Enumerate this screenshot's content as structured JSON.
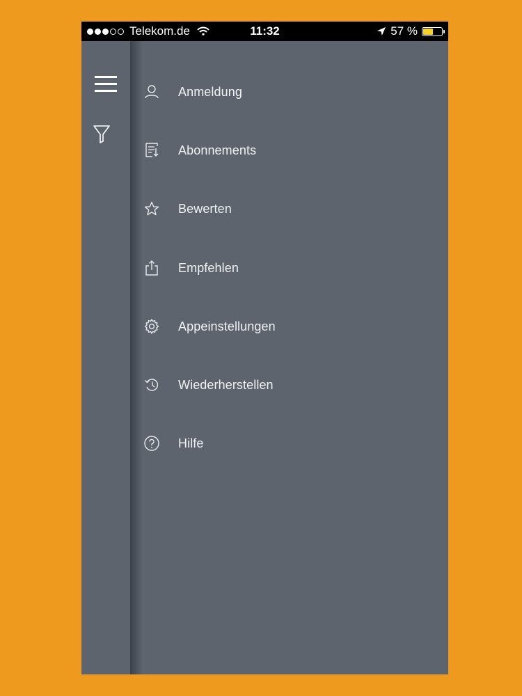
{
  "status_bar": {
    "carrier": "Telekom.de",
    "time": "11:32",
    "battery_text": "57 %",
    "battery_level_percent": 57,
    "signal_bars_filled": 3,
    "signal_bars_total": 5
  },
  "rail": {
    "menu_icon": "hamburger-icon",
    "filter_icon": "filter-icon"
  },
  "menu": {
    "items": [
      {
        "label": "Anmeldung",
        "icon": "user-icon"
      },
      {
        "label": "Abonnements",
        "icon": "subscription-icon"
      },
      {
        "label": "Bewerten",
        "icon": "star-icon"
      },
      {
        "label": "Empfehlen",
        "icon": "share-icon"
      },
      {
        "label": "Appeinstellungen",
        "icon": "gear-icon"
      },
      {
        "label": "Wiederherstellen",
        "icon": "restore-icon"
      },
      {
        "label": "Hilfe",
        "icon": "help-icon"
      }
    ]
  },
  "colors": {
    "background": "#EE9A1E",
    "panel": "#5E646E",
    "status_bar": "#000000",
    "text": "#F0F1F3",
    "battery": "#F5D327"
  }
}
